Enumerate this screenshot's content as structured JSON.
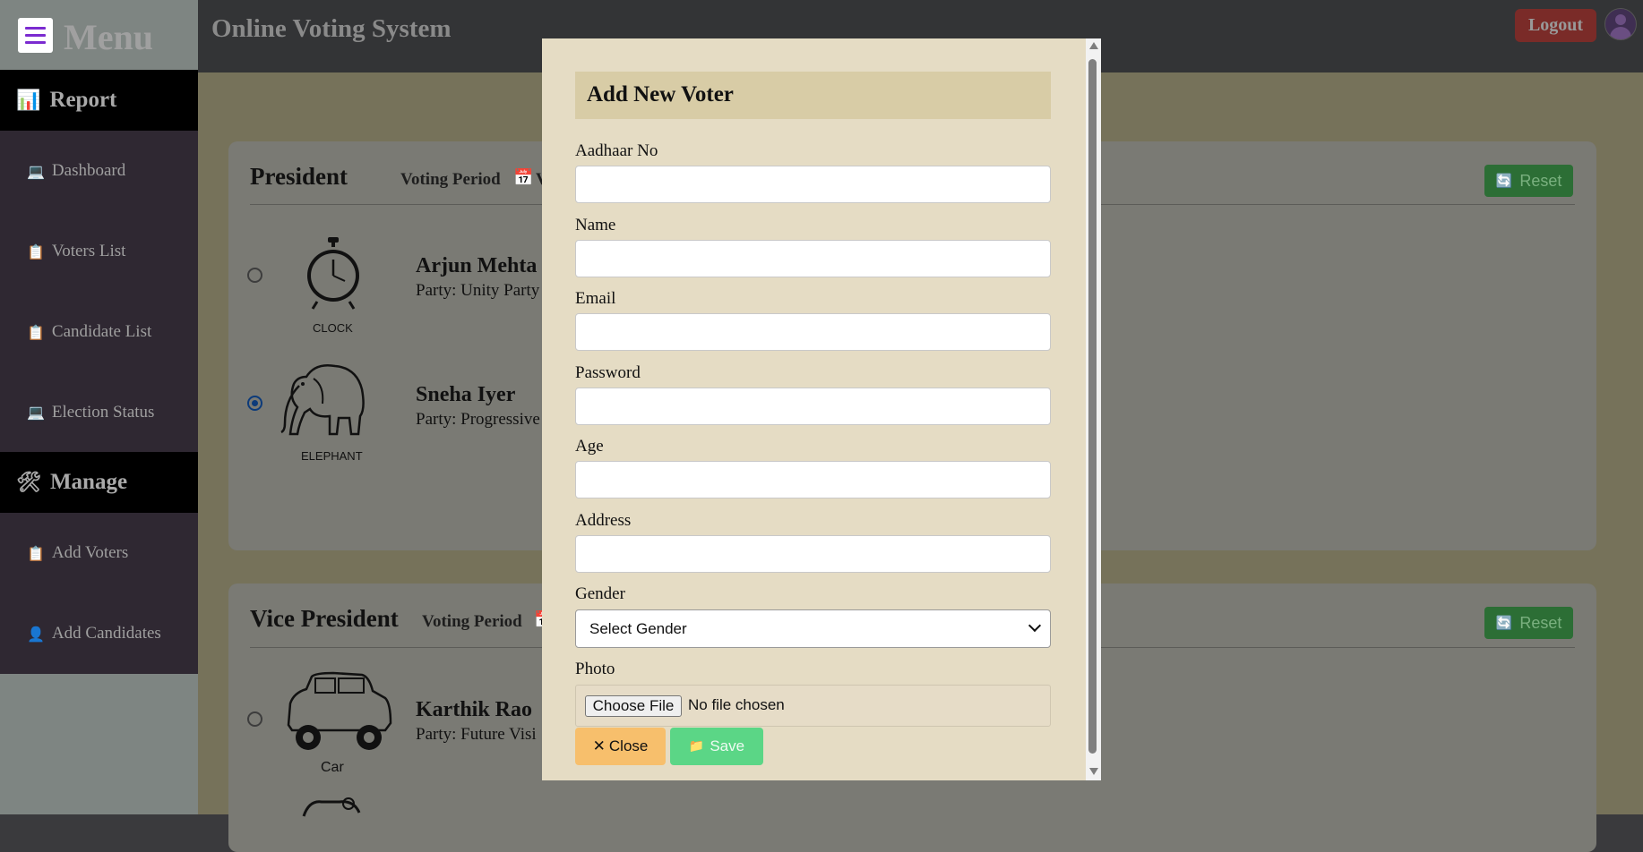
{
  "sidebar": {
    "menu_title": "Menu",
    "sections": [
      {
        "label": "Report",
        "icon": "bar-chart-icon",
        "glyph": "📊"
      },
      {
        "label": "Manage",
        "icon": "tools-icon",
        "glyph": "🛠"
      }
    ],
    "items": [
      {
        "label": "Dashboard",
        "icon": "laptop-icon",
        "glyph": "💻"
      },
      {
        "label": "Voters List",
        "icon": "clipboard-icon",
        "glyph": "📋"
      },
      {
        "label": "Candidate List",
        "icon": "clipboard-icon",
        "glyph": "📋"
      },
      {
        "label": "Election Status",
        "icon": "laptop-icon",
        "glyph": "💻"
      },
      {
        "label": "Add Voters",
        "icon": "clipboard-plus-icon",
        "glyph": "📋"
      },
      {
        "label": "Add Candidates",
        "icon": "user-icon",
        "glyph": "👤"
      }
    ]
  },
  "header": {
    "title": "Online Voting System",
    "logout_label": "Logout"
  },
  "elections": [
    {
      "position": "President",
      "voting_period_label": "Voting Period",
      "voting_period_text": "Voti",
      "reset_label": "Reset",
      "candidates": [
        {
          "name": "Arjun Mehta",
          "party": "Party: Unity Party",
          "symbol": "CLOCK",
          "selected": false
        },
        {
          "name": "Sneha Iyer",
          "party": "Party: Progressive",
          "symbol": "ELEPHANT",
          "selected": true
        }
      ]
    },
    {
      "position": "Vice President",
      "voting_period_label": "Voting Period",
      "reset_label": "Reset",
      "candidates": [
        {
          "name": "Karthik Rao",
          "party": "Party: Future Visi",
          "symbol": "Car",
          "selected": false
        }
      ]
    }
  ],
  "modal": {
    "title": "Add New Voter",
    "fields": {
      "aadhaar": {
        "label": "Aadhaar No",
        "value": ""
      },
      "name": {
        "label": "Name",
        "value": ""
      },
      "email": {
        "label": "Email",
        "value": ""
      },
      "password": {
        "label": "Password",
        "value": ""
      },
      "age": {
        "label": "Age",
        "value": ""
      },
      "address": {
        "label": "Address",
        "value": ""
      }
    },
    "gender": {
      "label": "Gender",
      "selected": "Select Gender"
    },
    "photo": {
      "label": "Photo",
      "button": "Choose File",
      "status": "No file chosen"
    },
    "close_label": "Close",
    "save_label": "Save"
  },
  "colors": {
    "modal_bg": "#e5dcc4",
    "modal_header": "#d8cca6",
    "close_button": "#f7bf6c",
    "save_button": "#5bd686",
    "reset_button": "#2c6e35",
    "logout_button": "#7a2b28",
    "accent_purple": "#7b2bd0"
  }
}
